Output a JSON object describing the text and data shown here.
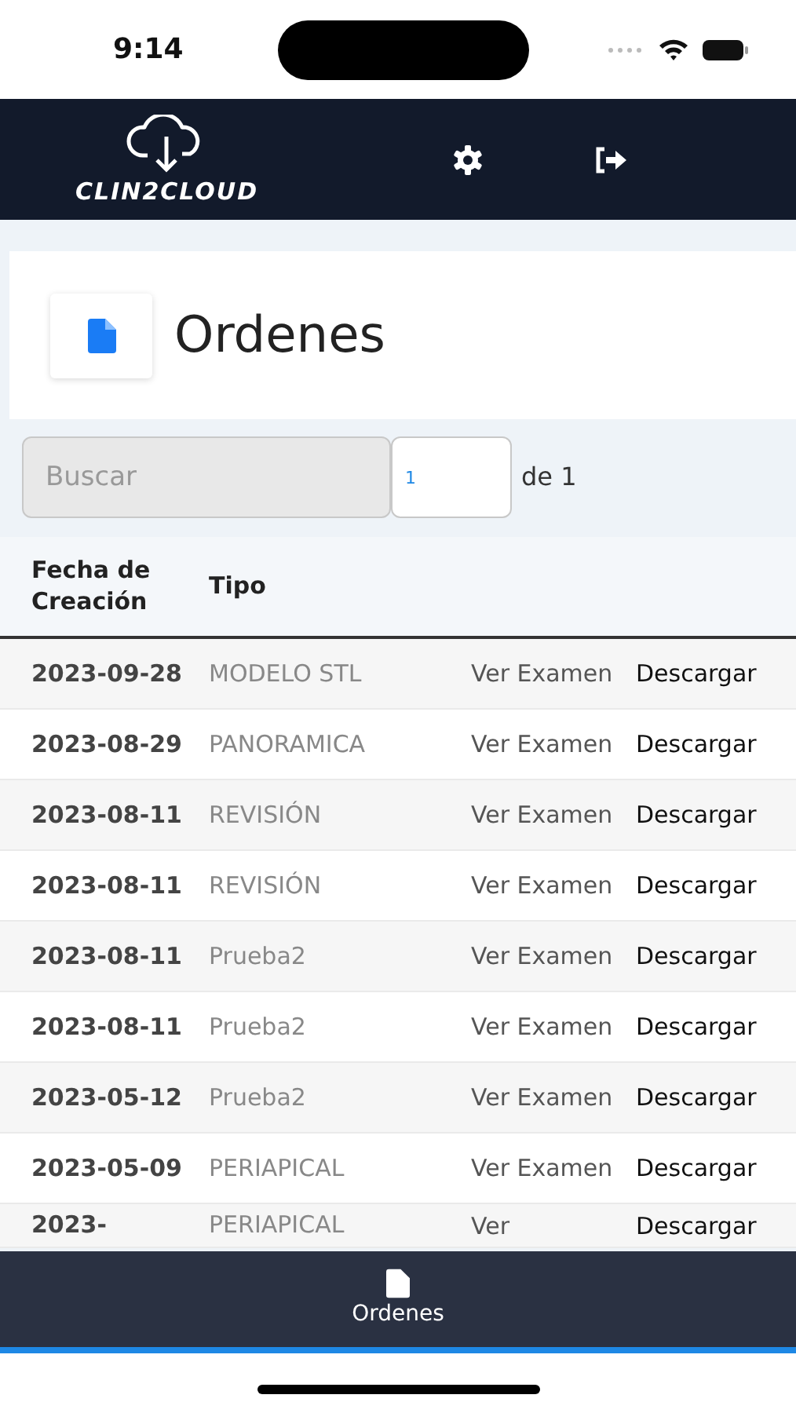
{
  "status_bar": {
    "time": "9:14"
  },
  "navbar": {
    "brand": "CLIN2CLOUD"
  },
  "page": {
    "title": "Ordenes"
  },
  "search": {
    "placeholder": "Buscar"
  },
  "pager": {
    "page": "1",
    "total_label": "de 1"
  },
  "table": {
    "columns": [
      "Fecha de Creación",
      "Tipo"
    ],
    "rows": [
      {
        "date": "2023-09-28",
        "type": "MODELO STL",
        "view": "Ver Examen",
        "download": "Descargar"
      },
      {
        "date": "2023-08-29",
        "type": "PANORAMICA",
        "view": "Ver Examen",
        "download": "Descargar"
      },
      {
        "date": "2023-08-11",
        "type": "REVISIÓN",
        "view": "Ver Examen",
        "download": "Descargar"
      },
      {
        "date": "2023-08-11",
        "type": "REVISIÓN",
        "view": "Ver Examen",
        "download": "Descargar"
      },
      {
        "date": "2023-08-11",
        "type": "Prueba2",
        "view": "Ver Examen",
        "download": "Descargar"
      },
      {
        "date": "2023-08-11",
        "type": "Prueba2",
        "view": "Ver Examen",
        "download": "Descargar"
      },
      {
        "date": "2023-05-12",
        "type": "Prueba2",
        "view": "Ver Examen",
        "download": "Descargar"
      },
      {
        "date": "2023-05-09",
        "type": "PERIAPICAL",
        "view": "Ver Examen",
        "download": "Descargar"
      },
      {
        "date": "2023-",
        "type": "PERIAPICAL",
        "view": "Ver",
        "download": "Descargar"
      }
    ]
  },
  "bottom_nav": [
    {
      "label": "Ordenes",
      "selected": true
    }
  ]
}
